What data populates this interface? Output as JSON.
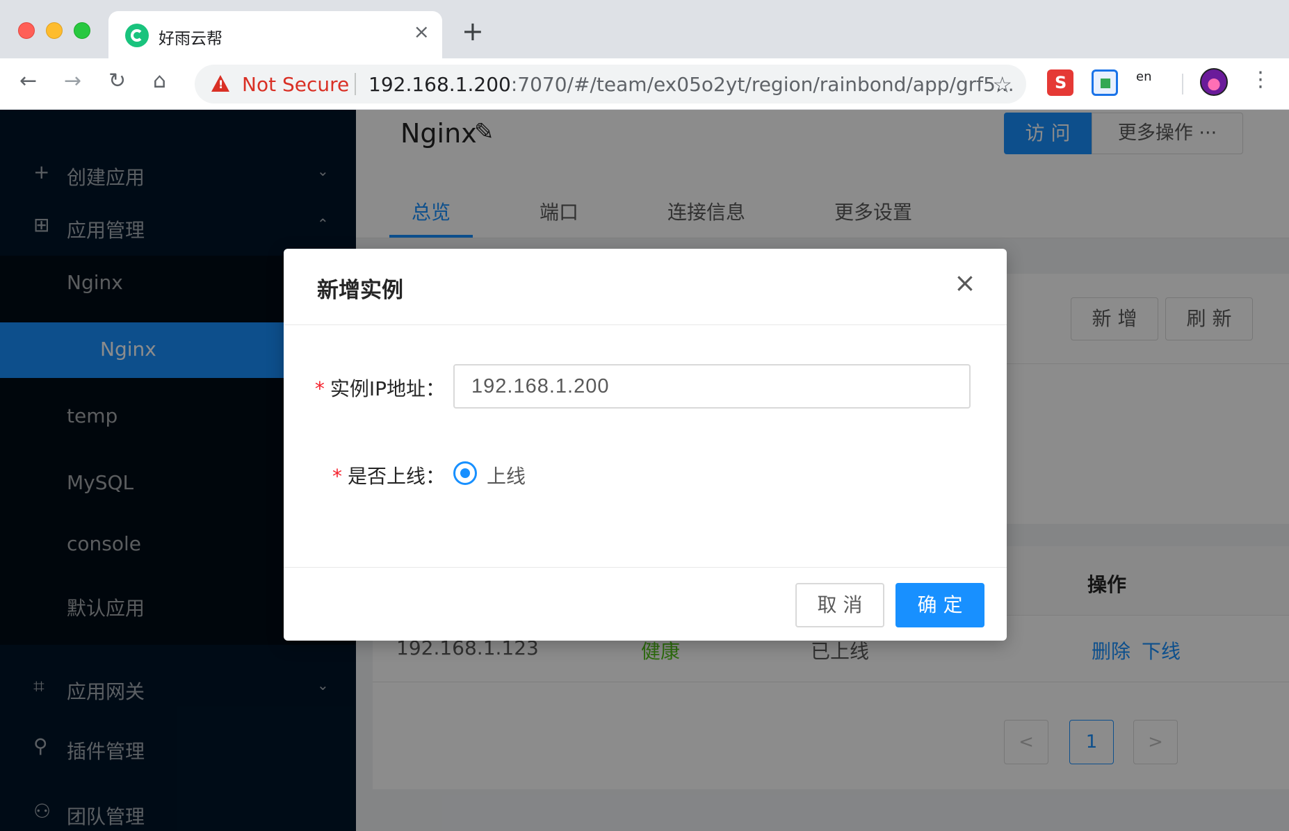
{
  "browser": {
    "tab_title": "好雨云帮",
    "tab_close": "×",
    "new_tab": "+",
    "security_label": "Not Secure",
    "url_host": "192.168.1.200",
    "url_rest": ":7070/#/team/ex05o2yt/region/rainbond/app/grf5...",
    "ext_3_label": "en"
  },
  "sidebar": {
    "create_app": "创建应用",
    "app_manage": "应用管理",
    "sub_items": [
      "Nginx",
      "Nginx",
      "temp",
      "MySQL",
      "console",
      "默认应用"
    ],
    "gateway": "应用网关",
    "plugins": "插件管理",
    "team": "团队管理"
  },
  "header": {
    "title": "Nginx",
    "visit_button": "访 问",
    "more_ops_button": "更多操作 ···",
    "tabs": [
      "总览",
      "端口",
      "连接信息",
      "更多设置"
    ]
  },
  "instances": {
    "add_button": "新 增",
    "refresh_button": "刷 新",
    "col_ops": "操作",
    "row": {
      "ip": "192.168.1.123",
      "health": "健康",
      "status": "已上线",
      "delete": "删除",
      "offline": "下线"
    },
    "pager": {
      "prev": "<",
      "current": "1",
      "next": ">"
    }
  },
  "modal": {
    "title": "新增实例",
    "close": "×",
    "ip_label": "实例IP地址：",
    "ip_value": "192.168.1.200",
    "online_label": "是否上线：",
    "online_option": "上线",
    "online_selected": true,
    "cancel": "取 消",
    "confirm": "确 定",
    "required_mark": "*"
  },
  "colors": {
    "primary": "#1890ff",
    "sidebar_bg": "#001529",
    "success": "#52c41a",
    "danger": "#f5222d"
  },
  "icons": {
    "back": "arrow-left-icon",
    "forward": "arrow-right-icon",
    "reload": "reload-icon",
    "home": "home-icon",
    "star": "star-icon",
    "edit": "edit-icon"
  }
}
